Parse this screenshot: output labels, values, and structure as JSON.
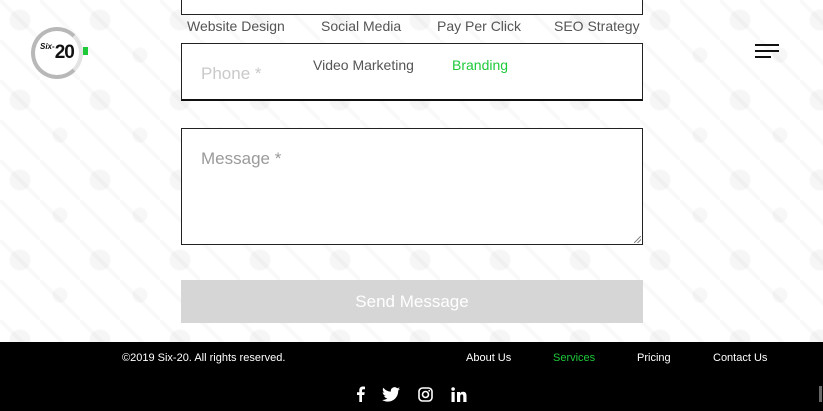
{
  "brand": {
    "logo_prefix": "Six",
    "logo_number": "20"
  },
  "form": {
    "services": [
      {
        "label": "Website Design",
        "selected": false
      },
      {
        "label": "Social Media",
        "selected": false
      },
      {
        "label": "Pay Per Click",
        "selected": false
      },
      {
        "label": "SEO Strategy",
        "selected": false
      },
      {
        "label": "Video Marketing",
        "selected": false
      },
      {
        "label": "Branding",
        "selected": true
      }
    ],
    "phone_placeholder": "Phone *",
    "message_placeholder": "Message *",
    "send_label": "Send Message"
  },
  "footer": {
    "copyright": "©2019 Six-20. All rights reserved.",
    "links": [
      {
        "label": "About Us",
        "active": false
      },
      {
        "label": "Services",
        "active": true
      },
      {
        "label": "Pricing",
        "active": false
      },
      {
        "label": "Contact Us",
        "active": false
      }
    ],
    "social": [
      "facebook-icon",
      "twitter-icon",
      "instagram-icon",
      "linkedin-icon"
    ]
  },
  "colors": {
    "accent": "#1ec93a",
    "footer_bg": "#000000",
    "button_bg": "#d6d6d6"
  }
}
